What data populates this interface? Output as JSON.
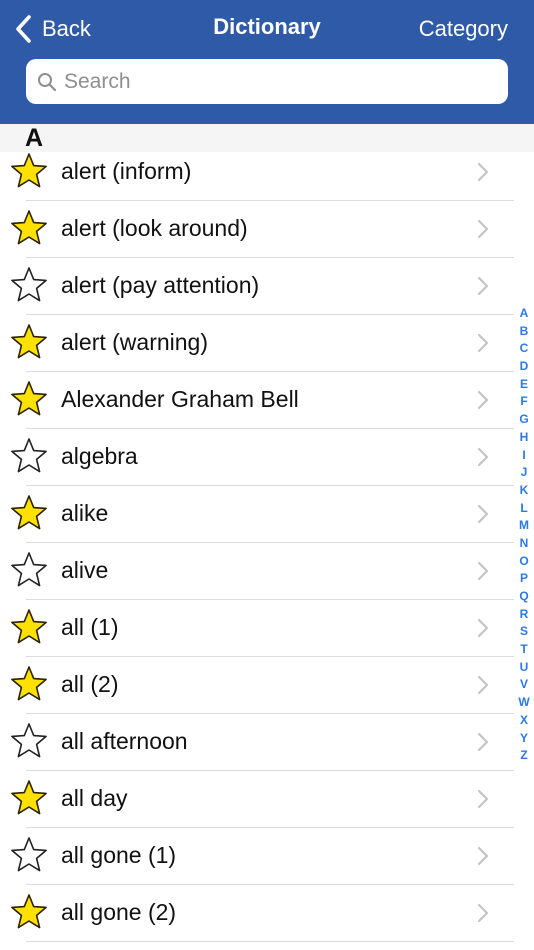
{
  "nav": {
    "back_label": "Back",
    "title": "Dictionary",
    "category_label": "Category"
  },
  "search": {
    "placeholder": "Search",
    "value": ""
  },
  "section": {
    "letter": "A"
  },
  "entries": [
    {
      "label": "alert (inform)",
      "favorite": true
    },
    {
      "label": "alert (look around)",
      "favorite": true
    },
    {
      "label": "alert (pay attention)",
      "favorite": false
    },
    {
      "label": "alert (warning)",
      "favorite": true
    },
    {
      "label": "Alexander Graham Bell",
      "favorite": true
    },
    {
      "label": "algebra",
      "favorite": false
    },
    {
      "label": "alike",
      "favorite": true
    },
    {
      "label": "alive",
      "favorite": false
    },
    {
      "label": "all (1)",
      "favorite": true
    },
    {
      "label": "all (2)",
      "favorite": true
    },
    {
      "label": "all afternoon",
      "favorite": false
    },
    {
      "label": "all day",
      "favorite": true
    },
    {
      "label": "all gone (1)",
      "favorite": false
    },
    {
      "label": "all gone (2)",
      "favorite": true
    }
  ],
  "index_letters": [
    "A",
    "B",
    "C",
    "D",
    "E",
    "F",
    "G",
    "H",
    "I",
    "J",
    "K",
    "L",
    "M",
    "N",
    "O",
    "P",
    "Q",
    "R",
    "S",
    "T",
    "U",
    "V",
    "W",
    "X",
    "Y",
    "Z"
  ],
  "colors": {
    "header_bg": "#2f5aa8",
    "star_fill": "#ffe100",
    "index_text": "#2b79e8"
  },
  "icons": {
    "back": "chevron-left-icon",
    "search": "magnifier-icon",
    "favorite_on": "star-filled-icon",
    "favorite_off": "star-outline-icon",
    "row_disclosure": "chevron-right-icon"
  }
}
